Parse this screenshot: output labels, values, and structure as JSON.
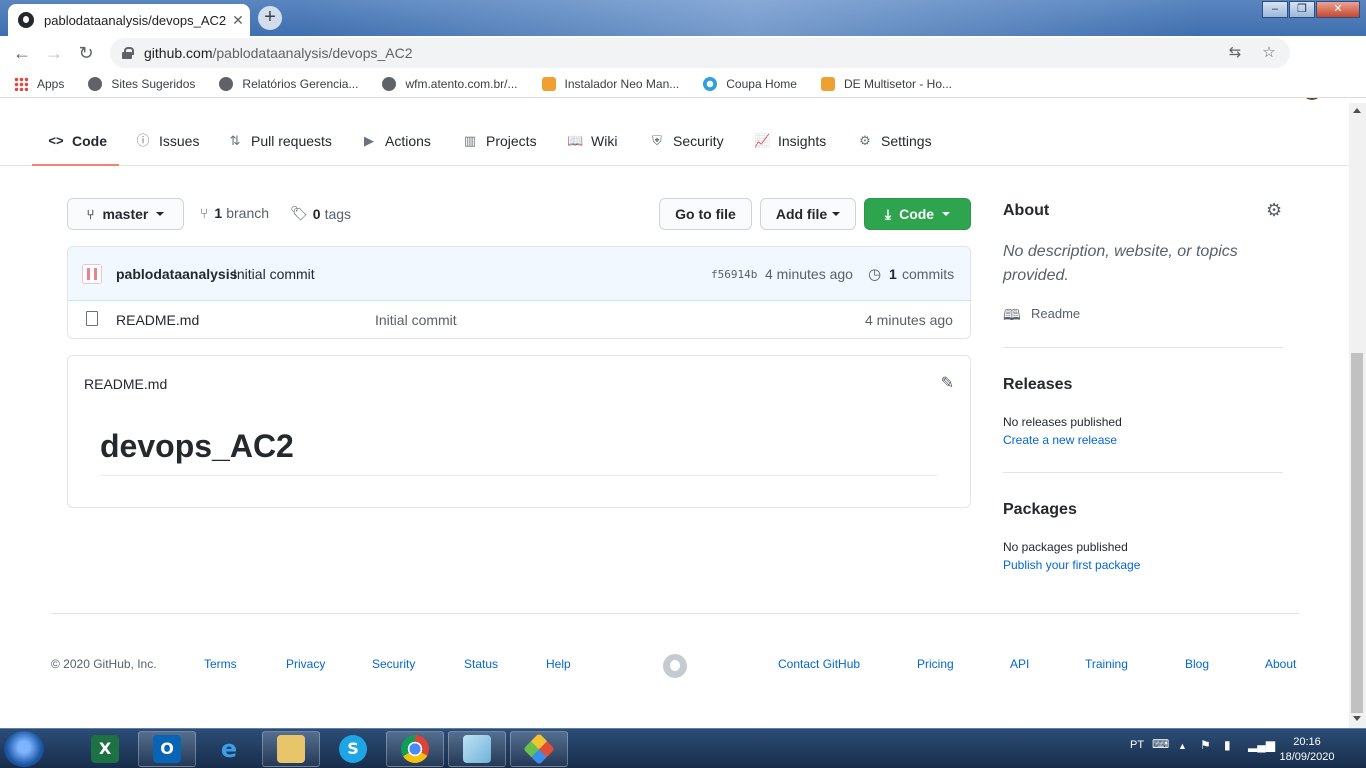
{
  "browser": {
    "tab_title": "pablodataanalysis/devops_AC2",
    "tab_close": "✕",
    "new_tab": "+",
    "url_host": "github.com",
    "url_path": "/pablodataanalysis/devops_AC2",
    "window_min": "–",
    "window_max": "❐",
    "window_close": "✕",
    "bookmarks": [
      {
        "label": "Apps"
      },
      {
        "label": "Sites Sugeridos"
      },
      {
        "label": "Relatórios Gerencia..."
      },
      {
        "label": "wfm.atento.com.br/..."
      },
      {
        "label": "Instalador Neo Man..."
      },
      {
        "label": "Coupa Home"
      },
      {
        "label": "DE Multisetor - Ho..."
      }
    ]
  },
  "repo_nav": {
    "items": [
      {
        "label": "Code",
        "icon": "<>"
      },
      {
        "label": "Issues",
        "icon": "ⓘ"
      },
      {
        "label": "Pull requests",
        "icon": "⇅"
      },
      {
        "label": "Actions",
        "icon": "▶"
      },
      {
        "label": "Projects",
        "icon": "▥"
      },
      {
        "label": "Wiki",
        "icon": "📖"
      },
      {
        "label": "Security",
        "icon": "⛨"
      },
      {
        "label": "Insights",
        "icon": "📈"
      },
      {
        "label": "Settings",
        "icon": "⚙"
      }
    ],
    "active": "Code",
    "accent_color": "#f9826c"
  },
  "branch_bar": {
    "branch": "master",
    "branch_count": "1",
    "branch_word": "branch",
    "tag_count": "0",
    "tag_word": "tags",
    "go_to_file": "Go to file",
    "add_file": "Add file",
    "code_button": "Code"
  },
  "commit": {
    "author": "pablodataanalysis",
    "message": "Initial commit",
    "sha": "f56914b",
    "time": "4 minutes ago",
    "count": "1",
    "count_word": "commits"
  },
  "files": [
    {
      "name": "README.md",
      "message": "Initial commit",
      "time": "4 minutes ago"
    }
  ],
  "readme": {
    "filename": "README.md",
    "heading": "devops_AC2"
  },
  "sidebar": {
    "about_title": "About",
    "about_desc": "No description, website, or topics provided.",
    "readme_link": "Readme",
    "releases_title": "Releases",
    "releases_none": "No releases published",
    "releases_link": "Create a new release",
    "packages_title": "Packages",
    "packages_none": "No packages published",
    "packages_link": "Publish your first package"
  },
  "footer": {
    "copyright": "© 2020 GitHub, Inc.",
    "left_links": [
      "Terms",
      "Privacy",
      "Security",
      "Status",
      "Help"
    ],
    "right_links": [
      "Contact GitHub",
      "Pricing",
      "API",
      "Training",
      "Blog",
      "About"
    ]
  },
  "taskbar": {
    "language": "PT",
    "time": "20:16",
    "date": "18/09/2020"
  },
  "colors": {
    "green_button": "#2ea44f",
    "link_blue": "#0366d6",
    "commit_bg": "#f1f8ff"
  }
}
